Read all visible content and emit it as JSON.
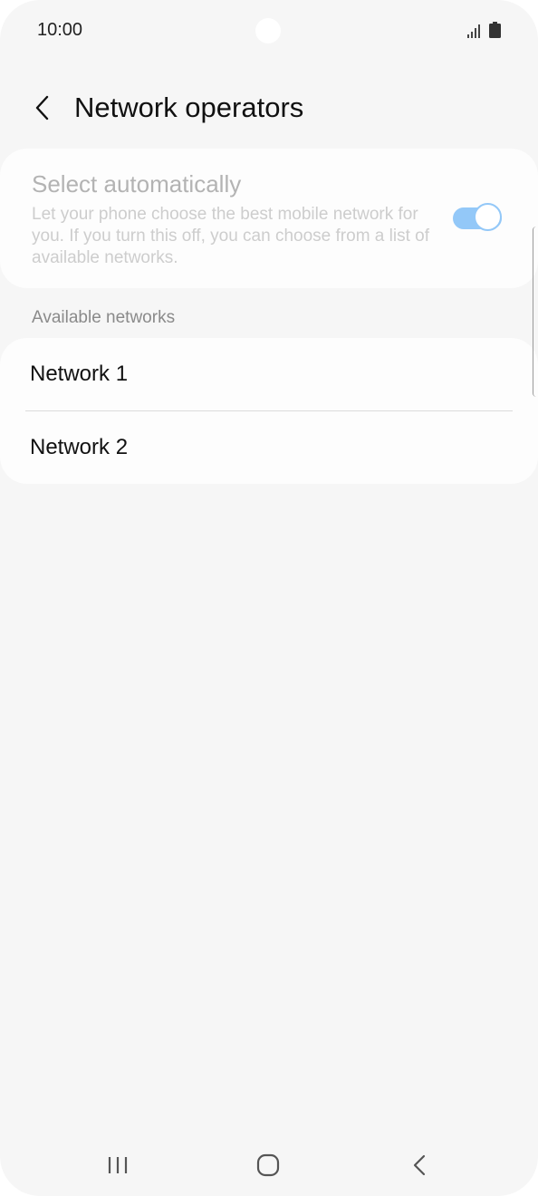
{
  "status_bar": {
    "time": "10:00",
    "icons": [
      "signal-icon",
      "battery-icon"
    ]
  },
  "header": {
    "title": "Network operators",
    "back_icon": "chevron-left-icon"
  },
  "select_automatically": {
    "title": "Select automatically",
    "description": "Let your phone choose the best mobile network for you. If you turn this off, you can choose from a list of available networks.",
    "enabled": true
  },
  "available_networks": {
    "header": "Available networks",
    "items": [
      {
        "label": "Network 1"
      },
      {
        "label": "Network 2"
      }
    ]
  },
  "nav_bar": {
    "icons": [
      "recents-icon",
      "home-icon",
      "back-icon"
    ]
  },
  "colors": {
    "background": "#f6f6f6",
    "card": "#fdfdfd",
    "toggle_accent": "#93c8f8",
    "disabled_title": "#b3b3b3",
    "disabled_text": "#cdcdcd",
    "section_header": "#8a8a8a"
  }
}
